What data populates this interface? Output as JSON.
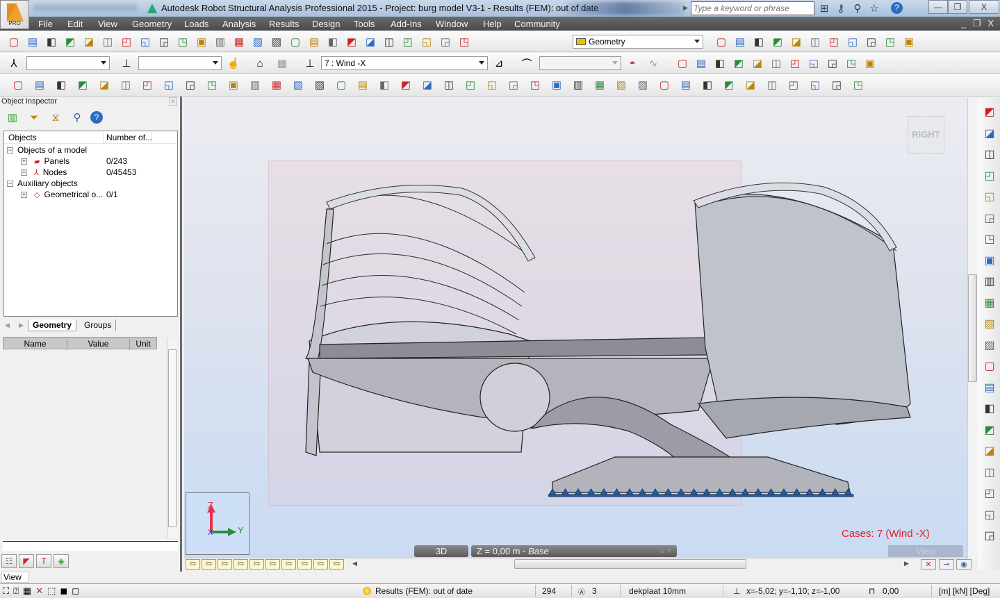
{
  "window": {
    "title": "Autodesk Robot Structural Analysis Professional 2015 - Project: burg model V3-1 - Results (FEM): out of date",
    "logo_label": "PRO",
    "search_placeholder": "Type a keyword or phrase",
    "title_icons": [
      "binoculars-icon",
      "key-icon",
      "satellite-icon",
      "star-icon",
      "help-icon"
    ],
    "controls": {
      "minimize": "—",
      "maximize": "❐",
      "close": "X"
    },
    "mdi_controls": "_ ❐ X"
  },
  "menu": [
    "File",
    "Edit",
    "View",
    "Geometry",
    "Loads",
    "Analysis",
    "Results",
    "Design",
    "Tools",
    "Add-Ins",
    "Window",
    "Help",
    "Community"
  ],
  "toolbar1": {
    "left_icons": [
      "new-icon",
      "open-icon",
      "save-icon",
      "print-icon",
      "print-preview-icon",
      "zoom-document-icon",
      "screen-capture-icon",
      "delete-icon",
      "copy-icon",
      "paste-icon",
      "undo-icon",
      "redo-icon",
      "calculator-icon",
      "table-icon",
      "lock-icon",
      "zoom-icon",
      "zoom-all-icon",
      "zoom-window-icon",
      "supports-icon",
      "measure-icon",
      "structure-view-icon",
      "section-icon",
      "layout-icon",
      "tools-icon",
      "layout-selection-icon"
    ],
    "layout_combo": "Geometry",
    "right_icons": [
      "magic-wand-icon",
      "select-panels-icon",
      "grid-icon",
      "lock-panels-icon",
      "unlock-panels-icon",
      "generate-mesh-icon",
      "delete-mesh-icon",
      "target-icon",
      "split-icon",
      "merge-icon",
      "group-icon"
    ]
  },
  "toolbar2": {
    "node_combo": "",
    "bar_combo": "",
    "load_case_combo": "7 : Wind -X",
    "mode_combo": "",
    "icons": [
      "node-query-icon",
      "bar-query-icon",
      "hand-query-icon",
      "view-icon",
      "disabled-icon",
      "case-query-icon",
      "case-sign-icon",
      "panel-results-icon",
      "load-diagram-icon",
      "mode-icon",
      "dots-grid-icon",
      "structural-axis-icon",
      "numbering-icon",
      "dimension-icon",
      "section-tables-icon",
      "folder-icon",
      "notes-icon",
      "calculator-icon",
      "help-icon",
      "legend-icon",
      "results-table-icon"
    ]
  },
  "toolbar3": {
    "icons": [
      "structure-model-icon",
      "section-def-icon",
      "rob-icon",
      "nodes-icon",
      "bars-icon",
      "panels-icon",
      "column-icon",
      "beam-icon",
      "slab-icon",
      "wall-icon",
      "opening-icon",
      "contour-icon",
      "polyline-icon",
      "release-icon",
      "bar-sections-icon",
      "panel-thickness-icon",
      "section-list-icon",
      "foundation-icon",
      "solids-icon",
      "profile-icon",
      "rigid-link-icon",
      "cladding-icon",
      "offsets-icon",
      "materials-icon",
      "supports-icon",
      "hinges-icon",
      "eccentricity-icon",
      "elastic-ground-icon",
      "bracing-icon",
      "spring-icon",
      "cable-icon",
      "arc-icon",
      "frame-icon",
      "diaphragm-icon",
      "plate-icon",
      "load-definition-icon",
      "uniform-load-icon",
      "point-load-icon",
      "moving-load-icon",
      "help-load-icon"
    ]
  },
  "object_inspector": {
    "title": "Object Inspector",
    "columns": [
      "Objects",
      "Number of..."
    ],
    "tree": [
      {
        "label": "Objects of a model",
        "count": "",
        "level": 0,
        "expander": "−"
      },
      {
        "label": "Panels",
        "count": "0/243",
        "level": 1,
        "expander": "+",
        "icon": "panel-icon"
      },
      {
        "label": "Nodes",
        "count": "0/45453",
        "level": 1,
        "expander": "+",
        "icon": "node-icon"
      },
      {
        "label": "Auxiliary objects",
        "count": "",
        "level": 0,
        "expander": "−"
      },
      {
        "label": "Geometrical o...",
        "count": "0/1",
        "level": 1,
        "expander": "+",
        "icon": "geometry-object-icon"
      }
    ],
    "tabs": [
      "Geometry",
      "Groups"
    ],
    "active_tab": "Geometry",
    "property_columns": [
      "Name",
      "Value",
      "Unit"
    ]
  },
  "viewport": {
    "view_cube_label": "RIGHT",
    "cases_label": "Cases: 7 (Wind -X)",
    "view_mode": "3D",
    "level": "Z = 0,00 m - ",
    "level_name": "Base",
    "view_ghost_label": "View",
    "axes": {
      "z": "Z",
      "y": "Y",
      "x": "X"
    },
    "colors": {
      "cases": "#e0202a",
      "axis_z": "#e8324a",
      "axis_y": "#2e8b3a",
      "axis_x": "#2a2ad0",
      "supports": "#1e4f8f"
    }
  },
  "view_label": "View",
  "status_bar": {
    "results_status": "Results (FEM): out of date",
    "node_count": "294",
    "selection_count": "3",
    "thickness": "dekplaat 10mm",
    "coordinates": "x=-5,02; y=-1,10; z=-1,00",
    "angle": "0,00",
    "units": "[m] [kN] [Deg]"
  }
}
